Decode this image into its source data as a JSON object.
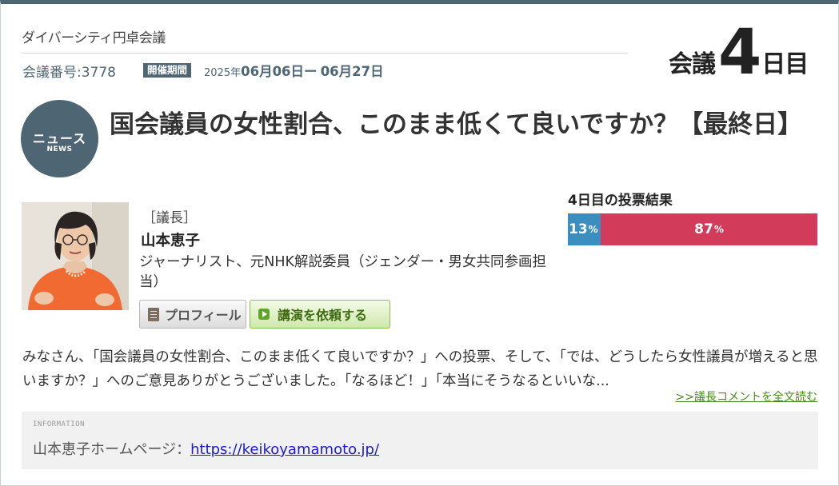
{
  "header": {
    "brand": "ダイバーシティ円卓会議",
    "meeting_number": "会議番号:3778",
    "period_label": "開催期間",
    "period_year": "2025年",
    "period_start": "06月06日",
    "period_separator": "ー",
    "period_end": "06月27日",
    "day_prefix": "会議",
    "day_number": "4",
    "day_suffix": "日目"
  },
  "news_badge": {
    "jp": "ニュース",
    "en": "NEWS"
  },
  "title": "国会議員の女性割合、このまま低くて良いですか？【最終日】",
  "chair": {
    "role": "［議長］",
    "name": "山本恵子",
    "description": "ジャーナリスト、元NHK解説委員（ジェンダー・男女共同参画担当）",
    "profile_button": "プロフィール",
    "lecture_button": "講演を依頼する"
  },
  "vote": {
    "title": "4日目の投票結果",
    "option_a_percent": "13",
    "option_b_percent": "87",
    "percent_sign": "%",
    "option_a_fraction": 0.13,
    "option_b_fraction": 0.87,
    "color_a": "#3a8fc0",
    "color_b": "#d33b5b"
  },
  "comment": {
    "text": "みなさん、「国会議員の女性割合、このまま低くて良いですか？」への投票、そして、「では、どうしたら女性議員が増えると思いますか？」へのご意見ありがとうございました。「なるほど！」「本当にそうなるといいな...",
    "read_more": ">>議長コメントを全文読む"
  },
  "info": {
    "label": "INFORMATION",
    "homepage_label": "山本恵子ホームページ：",
    "homepage_link": "https://keikoyamamoto.jp/"
  },
  "colors": {
    "accent": "#4e6674",
    "link_green": "#4a8a1e"
  }
}
